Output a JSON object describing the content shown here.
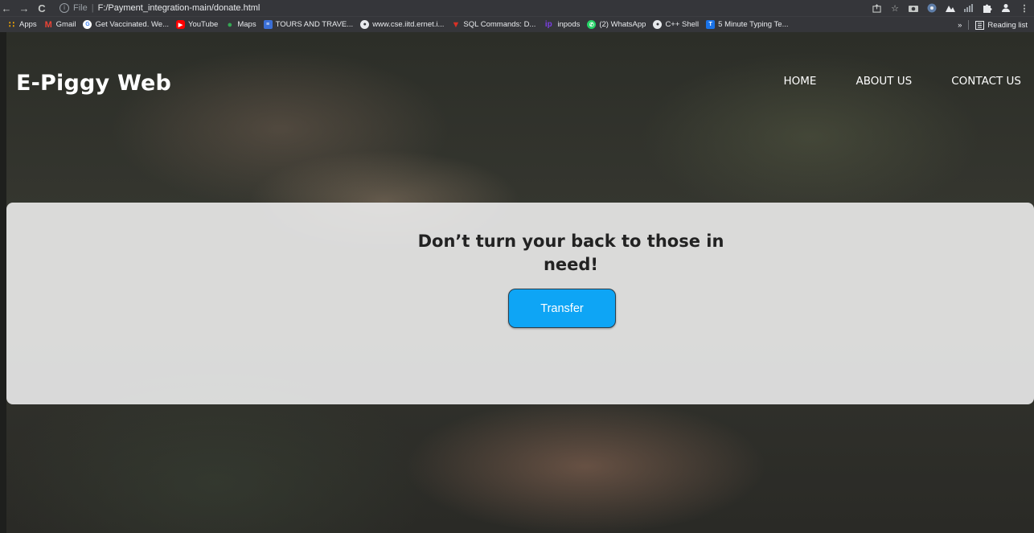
{
  "browser": {
    "back_icon": "arrow-left-icon",
    "forward_icon": "arrow-right-icon",
    "reload_icon": "reload-icon",
    "address": {
      "scheme": "File",
      "path": "F:/Payment_integration-main/donate.html"
    },
    "bookmarks": [
      {
        "label": "Apps",
        "icon": "apps-grid-icon",
        "color": "#f9ab00"
      },
      {
        "label": "Gmail",
        "icon": "gmail-icon",
        "color": "#ea4335"
      },
      {
        "label": "Get Vaccinated. We...",
        "icon": "google-icon",
        "color": "#4285f4"
      },
      {
        "label": "YouTube",
        "icon": "youtube-icon",
        "color": "#ff0000"
      },
      {
        "label": "Maps",
        "icon": "maps-pin-icon",
        "color": "#34a853"
      },
      {
        "label": "TOURS AND TRAVE...",
        "icon": "site-icon",
        "color": "#3b6fd6"
      },
      {
        "label": "www.cse.iitd.ernet.i...",
        "icon": "globe-icon",
        "color": "#9aa0a6"
      },
      {
        "label": "SQL Commands: D...",
        "icon": "sql-icon",
        "color": "#d93025"
      },
      {
        "label": "inpods",
        "icon": "inpods-icon",
        "color": "#7b3fe4"
      },
      {
        "label": "(2) WhatsApp",
        "icon": "whatsapp-icon",
        "color": "#25d366"
      },
      {
        "label": "C++ Shell",
        "icon": "globe-icon",
        "color": "#9aa0a6"
      },
      {
        "label": "5 Minute Typing Te...",
        "icon": "typing-icon",
        "color": "#1a73e8"
      }
    ],
    "more_bookmarks": "»",
    "reading_list": "Reading list"
  },
  "site": {
    "brand": "E-Piggy Web",
    "nav": [
      "HOME",
      "ABOUT US",
      "CONTACT US"
    ],
    "hero_title": "Don’t turn your back to those in need!",
    "transfer_label": "Transfer"
  },
  "colors": {
    "button": "#0ea5f5",
    "card": "#ececec",
    "chrome": "#35363a"
  }
}
